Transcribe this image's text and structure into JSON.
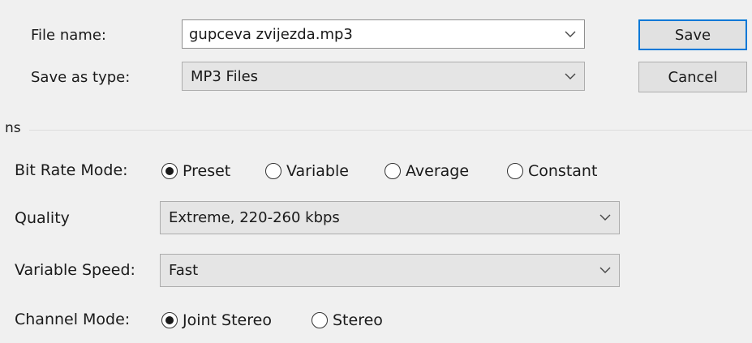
{
  "file": {
    "name_label": "File name:",
    "name_value": "gupceva zvijezda.mp3",
    "type_label": "Save as type:",
    "type_value": "MP3 Files"
  },
  "buttons": {
    "save": "Save",
    "cancel": "Cancel"
  },
  "options": {
    "group_title": "ns",
    "bitrate_label": "Bit Rate Mode:",
    "bitrate_modes": [
      {
        "label": "Preset",
        "selected": true
      },
      {
        "label": "Variable",
        "selected": false
      },
      {
        "label": "Average",
        "selected": false
      },
      {
        "label": "Constant",
        "selected": false
      }
    ],
    "quality_label": "Quality",
    "quality_value": "Extreme, 220-260 kbps",
    "speed_label": "Variable Speed:",
    "speed_value": "Fast",
    "channel_label": "Channel Mode:",
    "channel_modes": [
      {
        "label": "Joint Stereo",
        "selected": true
      },
      {
        "label": "Stereo",
        "selected": false
      }
    ]
  },
  "icons": {
    "dropdown": "chevron-down-icon",
    "radio": "radio-button-icon"
  },
  "colors": {
    "focus_border": "#0078d7",
    "background": "#f0f0f0"
  }
}
